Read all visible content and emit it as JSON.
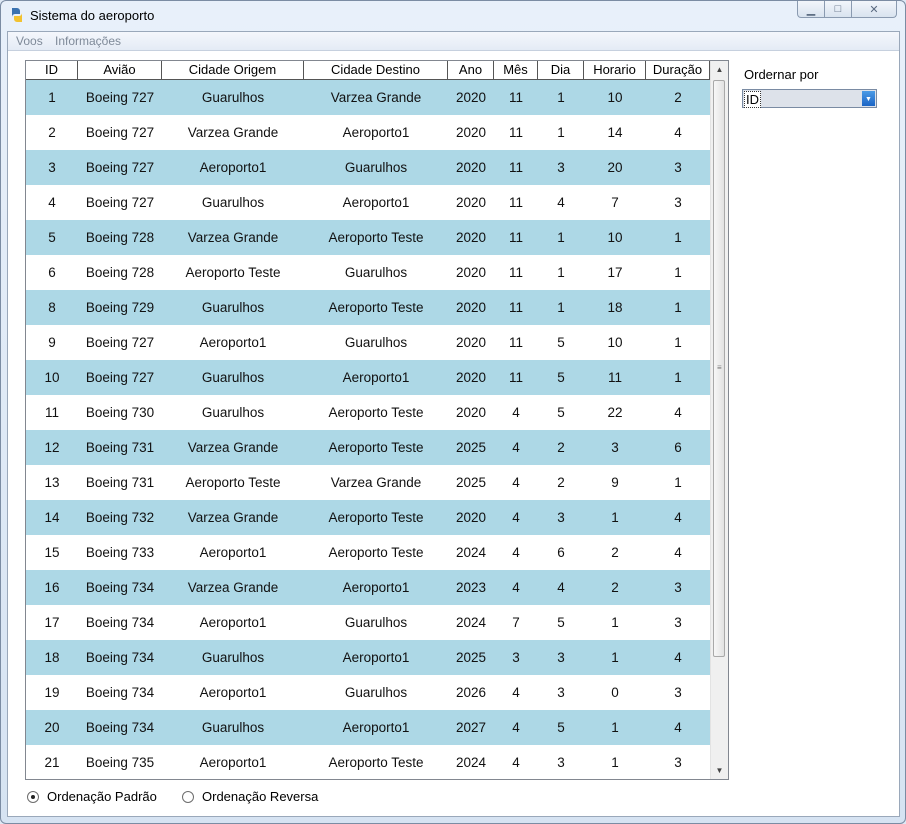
{
  "window": {
    "title": "Sistema do aeroporto"
  },
  "menu": {
    "items": [
      "Voos",
      "Informações"
    ]
  },
  "table": {
    "columns": [
      "ID",
      "Avião",
      "Cidade Origem",
      "Cidade Destino",
      "Ano",
      "Mês",
      "Dia",
      "Horario",
      "Duração"
    ],
    "rows": [
      [
        "1",
        "Boeing 727",
        "Guarulhos",
        "Varzea Grande",
        "2020",
        "11",
        "1",
        "10",
        "2"
      ],
      [
        "2",
        "Boeing 727",
        "Varzea Grande",
        "Aeroporto1",
        "2020",
        "11",
        "1",
        "14",
        "4"
      ],
      [
        "3",
        "Boeing 727",
        "Aeroporto1",
        "Guarulhos",
        "2020",
        "11",
        "3",
        "20",
        "3"
      ],
      [
        "4",
        "Boeing 727",
        "Guarulhos",
        "Aeroporto1",
        "2020",
        "11",
        "4",
        "7",
        "3"
      ],
      [
        "5",
        "Boeing 728",
        "Varzea Grande",
        "Aeroporto Teste",
        "2020",
        "11",
        "1",
        "10",
        "1"
      ],
      [
        "6",
        "Boeing 728",
        "Aeroporto Teste",
        "Guarulhos",
        "2020",
        "11",
        "1",
        "17",
        "1"
      ],
      [
        "8",
        "Boeing 729",
        "Guarulhos",
        "Aeroporto Teste",
        "2020",
        "11",
        "1",
        "18",
        "1"
      ],
      [
        "9",
        "Boeing 727",
        "Aeroporto1",
        "Guarulhos",
        "2020",
        "11",
        "5",
        "10",
        "1"
      ],
      [
        "10",
        "Boeing 727",
        "Guarulhos",
        "Aeroporto1",
        "2020",
        "11",
        "5",
        "11",
        "1"
      ],
      [
        "11",
        "Boeing 730",
        "Guarulhos",
        "Aeroporto Teste",
        "2020",
        "4",
        "5",
        "22",
        "4"
      ],
      [
        "12",
        "Boeing 731",
        "Varzea Grande",
        "Aeroporto Teste",
        "2025",
        "4",
        "2",
        "3",
        "6"
      ],
      [
        "13",
        "Boeing 731",
        "Aeroporto Teste",
        "Varzea Grande",
        "2025",
        "4",
        "2",
        "9",
        "1"
      ],
      [
        "14",
        "Boeing 732",
        "Varzea Grande",
        "Aeroporto Teste",
        "2020",
        "4",
        "3",
        "1",
        "4"
      ],
      [
        "15",
        "Boeing 733",
        "Aeroporto1",
        "Aeroporto Teste",
        "2024",
        "4",
        "6",
        "2",
        "4"
      ],
      [
        "16",
        "Boeing 734",
        "Varzea Grande",
        "Aeroporto1",
        "2023",
        "4",
        "4",
        "2",
        "3"
      ],
      [
        "17",
        "Boeing 734",
        "Aeroporto1",
        "Guarulhos",
        "2024",
        "7",
        "5",
        "1",
        "3"
      ],
      [
        "18",
        "Boeing 734",
        "Guarulhos",
        "Aeroporto1",
        "2025",
        "3",
        "3",
        "1",
        "4"
      ],
      [
        "19",
        "Boeing 734",
        "Aeroporto1",
        "Guarulhos",
        "2026",
        "4",
        "3",
        "0",
        "3"
      ],
      [
        "20",
        "Boeing 734",
        "Guarulhos",
        "Aeroporto1",
        "2027",
        "4",
        "5",
        "1",
        "4"
      ],
      [
        "21",
        "Boeing 735",
        "Aeroporto1",
        "Aeroporto Teste",
        "2024",
        "4",
        "3",
        "1",
        "3"
      ]
    ]
  },
  "sort": {
    "label": "Ordernar por",
    "selected": "ID",
    "options": [
      {
        "label": "Ordenação Padrão",
        "checked": true
      },
      {
        "label": "Ordenação Reversa",
        "checked": false
      }
    ]
  },
  "colors": {
    "row_alt": "#add8e6",
    "row": "#ffffff",
    "accent": "#1b64c5"
  },
  "icons": {
    "app": "app-logo-icon",
    "minimize": "minimize-icon",
    "maximize": "maximize-icon",
    "close": "close-icon",
    "dropdown": "chevron-down-icon"
  }
}
